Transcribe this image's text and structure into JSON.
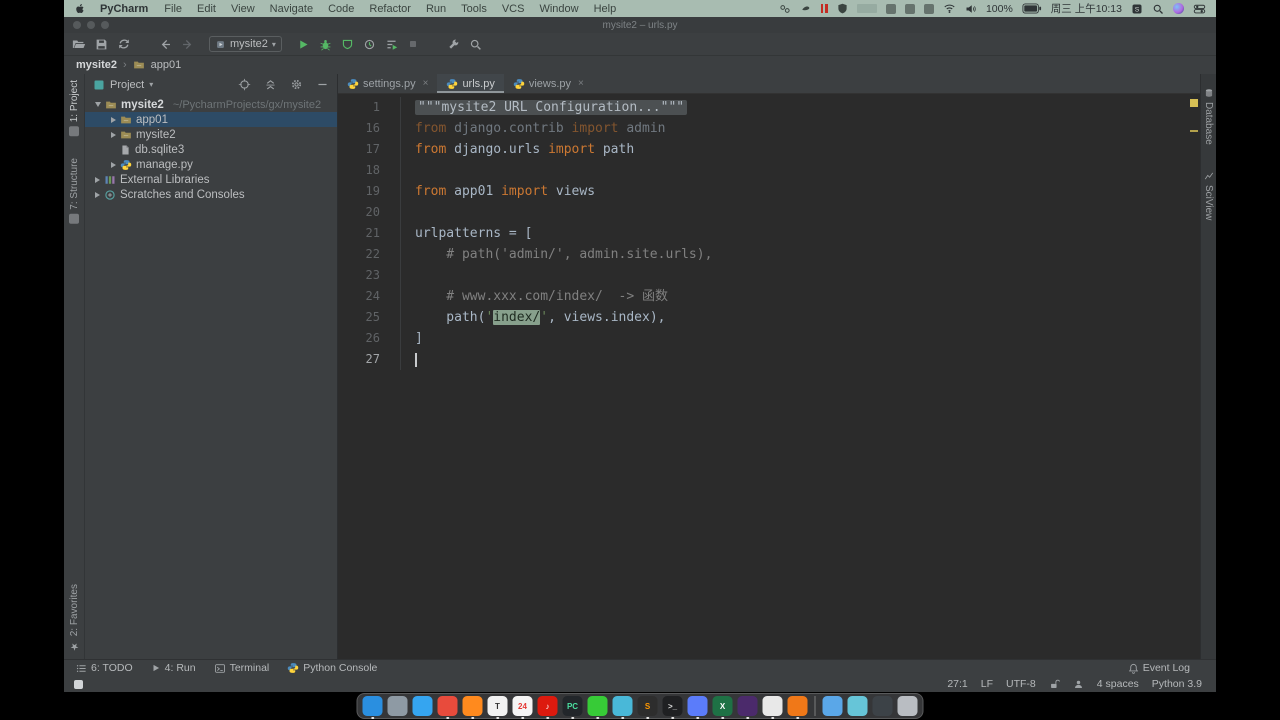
{
  "menubar": {
    "app_name": "PyCharm",
    "menus": [
      "File",
      "Edit",
      "View",
      "Navigate",
      "Code",
      "Refactor",
      "Run",
      "Tools",
      "VCS",
      "Window",
      "Help"
    ],
    "battery": "100%",
    "datetime": "周三 上午10:13",
    "status_icon_names": [
      "share-icon",
      "vpn-icon",
      "recording-pause-icon",
      "shield-icon",
      "stats-widget-icon",
      "app-square-1",
      "app-square-2",
      "app-square-3",
      "wifi-icon",
      "volume-icon",
      "battery-icon",
      "input-method-icon",
      "spotlight-icon",
      "siri-icon",
      "control-center-icon"
    ]
  },
  "window": {
    "title": "mysite2 – urls.py",
    "toolbar": {
      "run_config": "mysite2"
    },
    "breadcrumbs": [
      "mysite2",
      "app01"
    ],
    "left_stripe": {
      "top": [
        "1: Project",
        "7: Structure"
      ],
      "bottom": [
        "2: Favorites"
      ]
    },
    "right_stripe": [
      "Database",
      "SciView"
    ],
    "project_panel": {
      "header": "Project",
      "tree": [
        {
          "label": "mysite2",
          "hint": "~/PycharmProjects/gx/mysite2",
          "icon": "folder",
          "depth": 0,
          "arrow": "d",
          "bold": true
        },
        {
          "label": "app01",
          "icon": "folder",
          "depth": 1,
          "arrow": "r",
          "selected": true
        },
        {
          "label": "mysite2",
          "icon": "folder",
          "depth": 1,
          "arrow": "r"
        },
        {
          "label": "db.sqlite3",
          "icon": "file",
          "depth": 1,
          "arrow": "none"
        },
        {
          "label": "manage.py",
          "icon": "python",
          "depth": 1,
          "arrow": "r"
        },
        {
          "label": "External Libraries",
          "icon": "libs",
          "depth": 0,
          "arrow": "r"
        },
        {
          "label": "Scratches and Consoles",
          "icon": "scratch",
          "depth": 0,
          "arrow": "r"
        }
      ]
    },
    "tabs": [
      {
        "label": "settings.py",
        "active": false,
        "close": true
      },
      {
        "label": "urls.py",
        "active": true,
        "close": false
      },
      {
        "label": "views.py",
        "active": false,
        "close": true
      }
    ],
    "editor": {
      "lines": [
        {
          "num": "1",
          "tokens": [
            {
              "c": "fold",
              "t": "\"\"\"mysite2 URL Configuration...\"\"\""
            }
          ]
        },
        {
          "num": "16",
          "dim": true,
          "tokens": [
            {
              "c": "kw",
              "t": "from "
            },
            {
              "c": "txt",
              "t": "django.contrib "
            },
            {
              "c": "kw",
              "t": "import "
            },
            {
              "c": "txt",
              "t": "admin"
            }
          ]
        },
        {
          "num": "17",
          "tokens": [
            {
              "c": "kw",
              "t": "from "
            },
            {
              "c": "txt",
              "t": "django.urls "
            },
            {
              "c": "kw",
              "t": "import "
            },
            {
              "c": "txt",
              "t": "path"
            }
          ]
        },
        {
          "num": "18",
          "tokens": []
        },
        {
          "num": "19",
          "tokens": [
            {
              "c": "kw",
              "t": "from "
            },
            {
              "c": "txt",
              "t": "app01 "
            },
            {
              "c": "kw",
              "t": "import "
            },
            {
              "c": "txt",
              "t": "views"
            }
          ]
        },
        {
          "num": "20",
          "tokens": []
        },
        {
          "num": "21",
          "tokens": [
            {
              "c": "txt",
              "t": "urlpatterns = ["
            }
          ]
        },
        {
          "num": "22",
          "tokens": [
            {
              "c": "com",
              "t": "    # path('admin/', admin.site.urls),"
            }
          ]
        },
        {
          "num": "23",
          "tokens": []
        },
        {
          "num": "24",
          "tokens": [
            {
              "c": "com",
              "t": "    # www.xxx.com/index/  -> 函数"
            }
          ]
        },
        {
          "num": "25",
          "tokens": [
            {
              "c": "txt",
              "t": "    path("
            },
            {
              "c": "str",
              "t": "'"
            },
            {
              "c": "hl",
              "t": "index/"
            },
            {
              "c": "str",
              "t": "'"
            },
            {
              "c": "txt",
              "t": ", views.index),"
            }
          ]
        },
        {
          "num": "26",
          "tokens": [
            {
              "c": "txt",
              "t": "]"
            }
          ]
        },
        {
          "num": "27",
          "caret": true,
          "tokens": []
        }
      ]
    },
    "tool_window_bar": {
      "left": [
        {
          "label": "6: TODO",
          "icon": "todo"
        },
        {
          "label": "4: Run",
          "icon": "runsmall"
        },
        {
          "label": "Terminal",
          "icon": "terminal"
        },
        {
          "label": "Python Console",
          "icon": "python"
        }
      ],
      "right": [
        {
          "label": "Event Log",
          "icon": "event"
        }
      ]
    },
    "status_bar": {
      "position": "27:1",
      "line_separator": "LF",
      "encoding": "UTF-8",
      "indent": "4 spaces",
      "interpreter": "Python 3.9"
    }
  },
  "dock": {
    "items": [
      {
        "name": "finder",
        "color": "#2a8fe0",
        "running": true
      },
      {
        "name": "launchpad",
        "color": "#8e9aa4",
        "running": false
      },
      {
        "name": "safari",
        "color": "#35a5f0",
        "running": false
      },
      {
        "name": "chrome",
        "color": "#e84b3c",
        "running": true
      },
      {
        "name": "firefox",
        "color": "#ff8a1e",
        "running": true
      },
      {
        "name": "typora",
        "color": "#f2f2f2",
        "glyph": "T",
        "glyph_color": "#333333",
        "running": true
      },
      {
        "name": "calendar",
        "color": "#f5f5f5",
        "glyph": "24",
        "glyph_color": "#e53935",
        "running": true
      },
      {
        "name": "netease-music",
        "color": "#dd1a0e",
        "glyph": "♪",
        "glyph_color": "#ffffff",
        "running": true
      },
      {
        "name": "pycharm",
        "color": "#22262a",
        "glyph": "PC",
        "glyph_color": "#4be0a0",
        "running": true
      },
      {
        "name": "wechat",
        "color": "#37cb37",
        "running": true
      },
      {
        "name": "remote-desktop",
        "color": "#49b8d8",
        "running": true
      },
      {
        "name": "sublime-text",
        "color": "#2d2d2d",
        "glyph": "S",
        "glyph_color": "#ff9800",
        "running": true
      },
      {
        "name": "terminal-app",
        "color": "#1f2022",
        "glyph": ">_",
        "glyph_color": "#dddddd",
        "running": true
      },
      {
        "name": "telegram",
        "color": "#5b7cfa",
        "running": true
      },
      {
        "name": "excel",
        "color": "#1e7145",
        "glyph": "X",
        "glyph_color": "#ffffff",
        "running": true
      },
      {
        "name": "ribbon-app",
        "color": "#4b2a6b",
        "running": true
      },
      {
        "name": "pinwheel-app",
        "color": "#e8e8e8",
        "running": true
      },
      {
        "name": "orange-app",
        "color": "#f07818",
        "running": true
      },
      {
        "name": "separator"
      },
      {
        "name": "folder-documents",
        "color": "#5aa7e8"
      },
      {
        "name": "folder-downloads",
        "color": "#66c5d8"
      },
      {
        "name": "minimized-window",
        "color": "#3c4247"
      },
      {
        "name": "trash",
        "color": "rgba(230,235,240,0.75)"
      }
    ]
  }
}
